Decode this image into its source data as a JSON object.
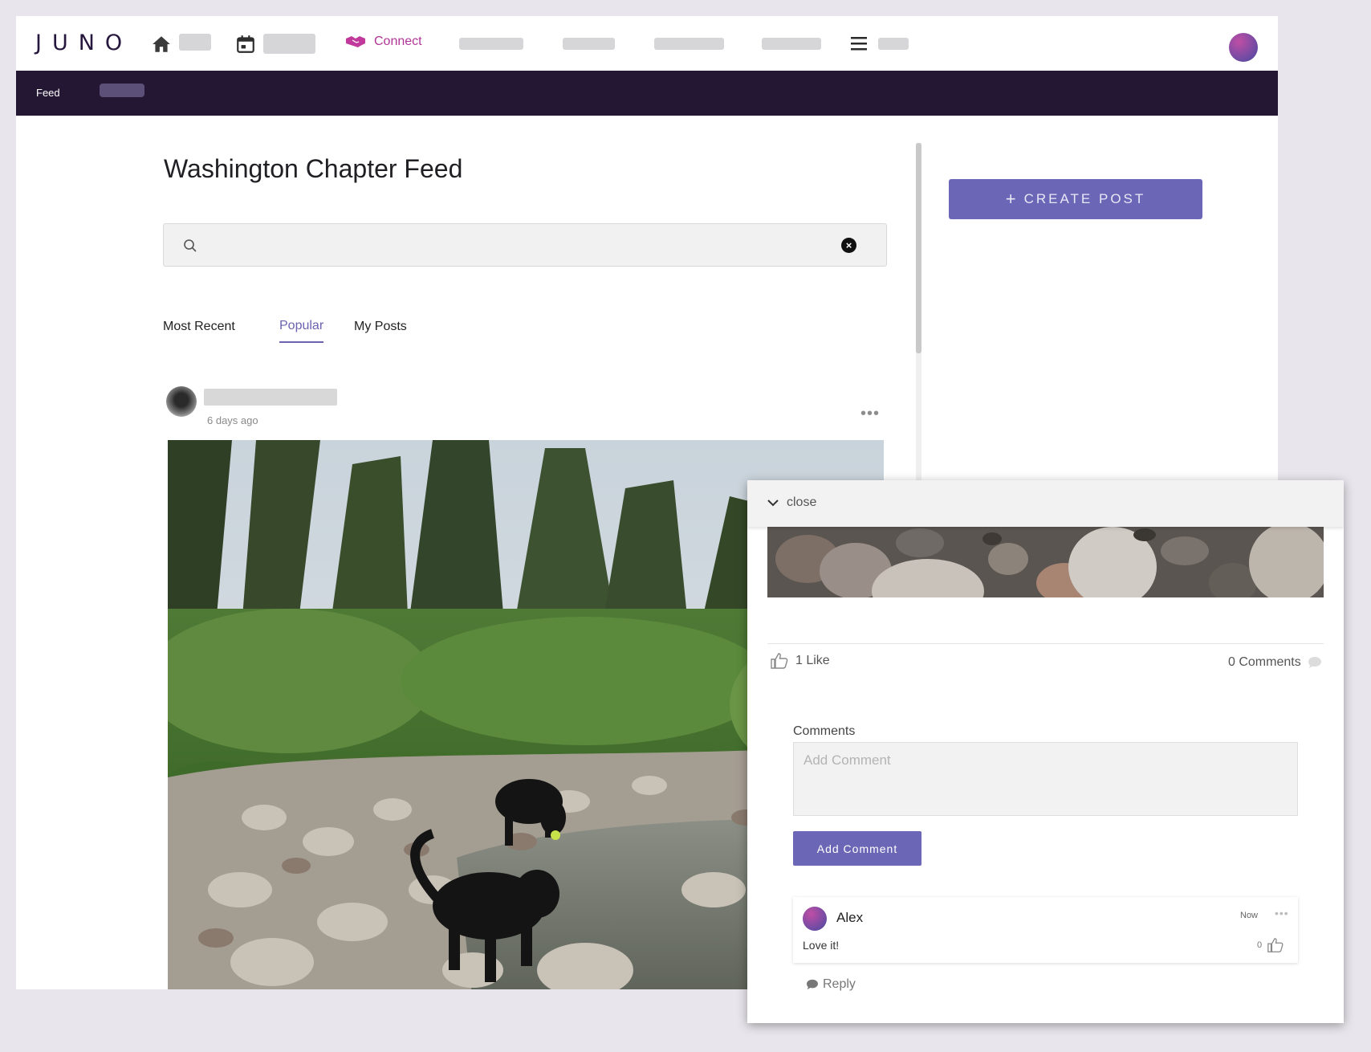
{
  "app": {
    "logo": "JUNO"
  },
  "nav": {
    "connect_label": "Connect",
    "accent_color": "#b03596"
  },
  "subnav": {
    "feed_label": "Feed"
  },
  "feed": {
    "title": "Washington Chapter Feed",
    "search": {
      "value": "",
      "placeholder": ""
    },
    "tabs": [
      {
        "label": "Most Recent",
        "active": false
      },
      {
        "label": "Popular",
        "active": true
      },
      {
        "label": "My Posts",
        "active": false
      }
    ],
    "post": {
      "time": "6 days ago",
      "more_label": "•••"
    },
    "create_post_label": "CREATE POST",
    "create_post_icon": "+"
  },
  "panel": {
    "close_label": "close",
    "likes_label": "1 Like",
    "comments_count_label": "0 Comments",
    "comments_heading": "Comments",
    "comment_input": {
      "value": "",
      "placeholder": "Add Comment"
    },
    "add_comment_label": "Add Comment",
    "comments": [
      {
        "author": "Alex",
        "time": "Now",
        "text": "Love it!",
        "likes": "0",
        "more_label": "•••"
      }
    ],
    "reply_label": "Reply"
  },
  "colors": {
    "brand_dark": "#241733",
    "primary_button": "#6b66b5",
    "active_tab": "#6b62b0"
  }
}
